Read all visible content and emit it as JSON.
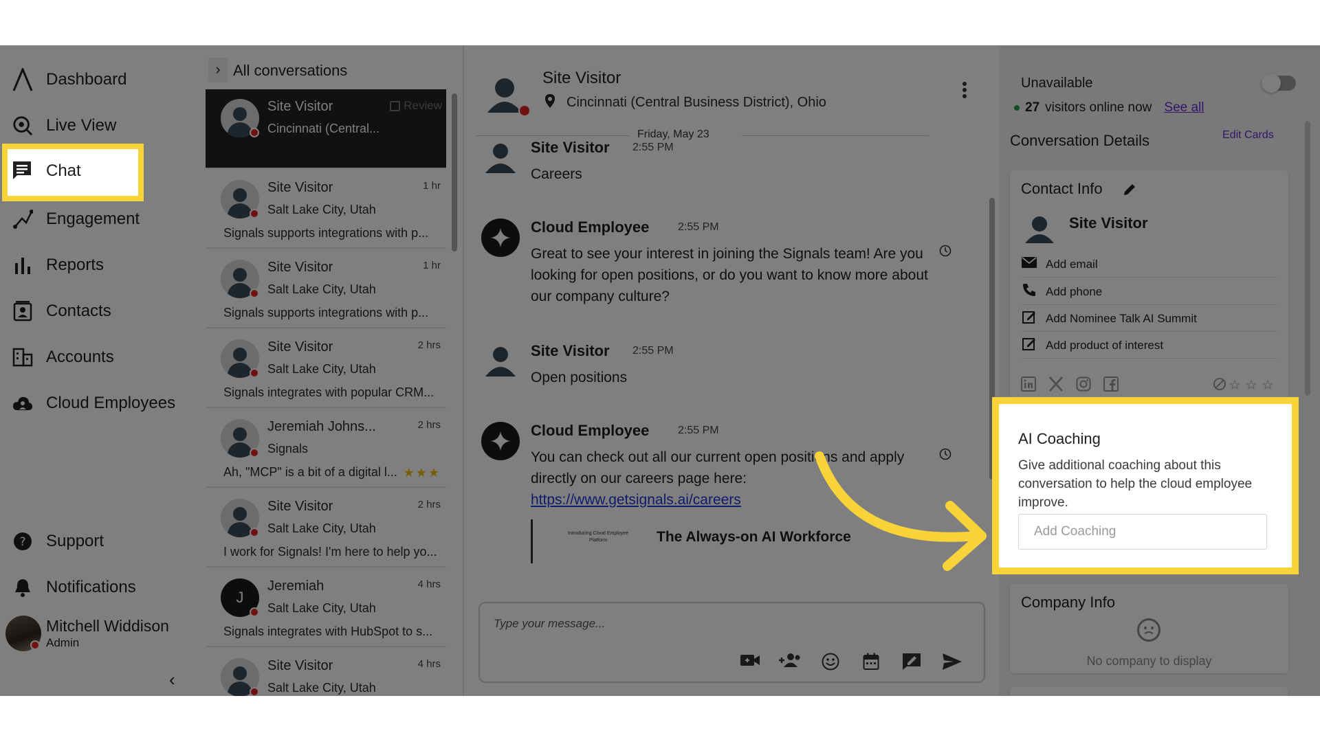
{
  "sidebar": {
    "items": [
      {
        "label": "Dashboard",
        "icon": "logo-icon"
      },
      {
        "label": "Live View",
        "icon": "live-view-icon"
      },
      {
        "label": "Chat",
        "icon": "chat-icon"
      },
      {
        "label": "Engagement",
        "icon": "engagement-icon"
      },
      {
        "label": "Reports",
        "icon": "bar-chart-icon"
      },
      {
        "label": "Contacts",
        "icon": "contacts-icon"
      },
      {
        "label": "Accounts",
        "icon": "building-icon"
      },
      {
        "label": "Cloud Employees",
        "icon": "cloud-user-icon"
      }
    ],
    "bottom": [
      {
        "label": "Support",
        "icon": "help-icon"
      },
      {
        "label": "Notifications",
        "icon": "bell-icon"
      }
    ],
    "user": {
      "name": "Mitchell Widdison",
      "role": "Admin"
    },
    "collapse_glyph": "‹"
  },
  "conversations": {
    "header": "All conversations",
    "expand_glyph": "›",
    "review_label": "Review",
    "items": [
      {
        "name": "Site Visitor",
        "location": "Cincinnati (Central...",
        "time": "",
        "snippet": "",
        "active": true
      },
      {
        "name": "Site Visitor",
        "location": "Salt Lake City, Utah",
        "time": "1 hr",
        "snippet": "Signals supports integrations with p..."
      },
      {
        "name": "Site Visitor",
        "location": "Salt Lake City, Utah",
        "time": "1 hr",
        "snippet": "Signals supports integrations with p..."
      },
      {
        "name": "Site Visitor",
        "location": "Salt Lake City, Utah",
        "time": "2 hrs",
        "snippet": "Signals integrates with popular CRM..."
      },
      {
        "name": "Jeremiah Johns...",
        "location": "Signals",
        "time": "2 hrs",
        "snippet": "Ah, \"MCP\" is a bit of a digital l...",
        "rating": 3
      },
      {
        "name": "Site Visitor",
        "location": "Salt Lake City, Utah",
        "time": "2 hrs",
        "snippet": "I work for Signals! I'm here to help yo..."
      },
      {
        "name": "Jeremiah",
        "location": "Salt Lake City, Utah",
        "time": "4 hrs",
        "snippet": "Signals integrates with HubSpot to s...",
        "initial": "J"
      },
      {
        "name": "Site Visitor",
        "location": "Salt Lake City, Utah",
        "time": "4 hrs",
        "snippet": ""
      }
    ]
  },
  "chat": {
    "title": "Site Visitor",
    "location": "Cincinnati (Central Business District), Ohio",
    "date": "Friday, May 23",
    "messages": [
      {
        "sender": "Site Visitor",
        "time": "2:55 PM",
        "text": "Careers",
        "type": "visitor"
      },
      {
        "sender": "Cloud Employee",
        "time": "2:55 PM",
        "text": "Great to see your interest in joining the Signals team! Are you looking for open positions, or do you want to know more about our company culture?",
        "type": "bot"
      },
      {
        "sender": "Site Visitor",
        "time": "2:55 PM",
        "text": "Open positions",
        "type": "visitor"
      },
      {
        "sender": "Cloud Employee",
        "time": "2:55 PM",
        "text": "You can check out all our current open positions and apply directly on our careers page here:",
        "link": "https://www.getsignals.ai/careers",
        "type": "bot"
      }
    ],
    "preview": {
      "title": "The Always-on AI Workforce",
      "thumb_text": "Introducing Cloud Employee Platform"
    },
    "composer_placeholder": "Type your message..."
  },
  "details": {
    "availability": "Unavailable",
    "visitors_count": "27",
    "visitors_text": "visitors online now",
    "see_all": "See all",
    "title": "Conversation Details",
    "edit_cards": "Edit Cards",
    "contact": {
      "title": "Contact Info",
      "name": "Site Visitor",
      "rows": [
        {
          "label": "Add email",
          "icon": "mail-icon"
        },
        {
          "label": "Add phone",
          "icon": "phone-icon"
        },
        {
          "label": "Add Nominee Talk AI Summit",
          "icon": "edit-note-icon"
        },
        {
          "label": "Add product of interest",
          "icon": "edit-note-icon"
        }
      ]
    },
    "coaching": {
      "title": "AI Coaching",
      "description": "Give additional coaching about this conversation to help the cloud employee improve.",
      "placeholder": "Add Coaching"
    },
    "company": {
      "title": "Company Info",
      "empty": "No company to display"
    }
  },
  "colors": {
    "highlight": "#f8d33a",
    "accent": "#6a2bd1",
    "status_red": "#e02424",
    "online_green": "#18a149",
    "link": "#1d34d6"
  }
}
